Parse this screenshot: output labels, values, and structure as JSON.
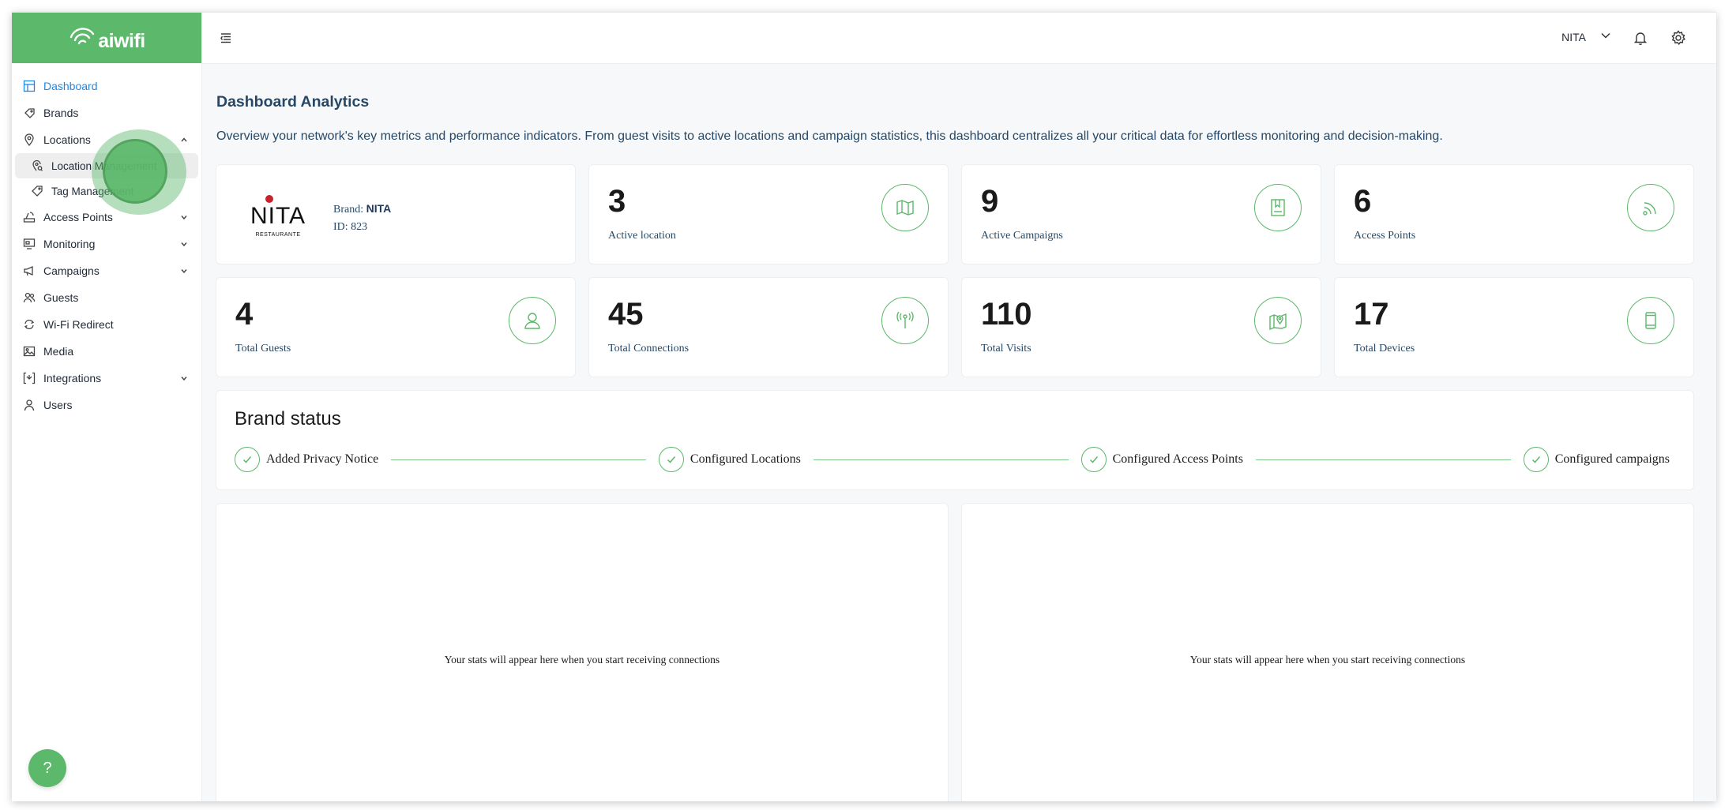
{
  "brand_app": {
    "logo_text": "aiwifi",
    "brand_color": "#5cb86a"
  },
  "sidebar": {
    "items": [
      {
        "label": "Dashboard",
        "icon": "dashboard-icon",
        "active": true
      },
      {
        "label": "Brands",
        "icon": "brands-icon"
      },
      {
        "label": "Locations",
        "icon": "location-pin-icon",
        "expanded": true
      },
      {
        "label": "Access Points",
        "icon": "access-point-icon"
      },
      {
        "label": "Monitoring",
        "icon": "monitor-icon"
      },
      {
        "label": "Campaigns",
        "icon": "megaphone-icon"
      },
      {
        "label": "Guests",
        "icon": "guests-icon"
      },
      {
        "label": "Wi-Fi Redirect",
        "icon": "redirect-icon"
      },
      {
        "label": "Media",
        "icon": "media-icon"
      },
      {
        "label": "Integrations",
        "icon": "integrations-icon"
      },
      {
        "label": "Users",
        "icon": "user-icon"
      }
    ],
    "locations_sub": [
      {
        "label": "Location Management",
        "icon": "location-search-icon",
        "selected": true
      },
      {
        "label": "Tag Management",
        "icon": "tag-icon"
      }
    ],
    "help_label": "?"
  },
  "topbar": {
    "user": "NITA"
  },
  "page": {
    "title": "Dashboard Analytics",
    "description": "Overview your network's key metrics and performance indicators. From guest visits to active locations and campaign statistics, this dashboard centralizes all your critical data for effortless monitoring and decision-making."
  },
  "brand_card": {
    "logo_word": "NITA",
    "logo_sub": "RESTAURANTE",
    "brand_prefix": "Brand: ",
    "brand_name": "NITA",
    "id_text": "ID: 823"
  },
  "stats": [
    {
      "value": "3",
      "label": "Active location",
      "icon": "map-icon"
    },
    {
      "value": "9",
      "label": "Active Campaigns",
      "icon": "book-icon"
    },
    {
      "value": "6",
      "label": "Access Points",
      "icon": "wifi-signal-icon"
    },
    {
      "value": "4",
      "label": "Total Guests",
      "icon": "guest-icon"
    },
    {
      "value": "45",
      "label": "Total Connections",
      "icon": "antenna-icon"
    },
    {
      "value": "110",
      "label": "Total Visits",
      "icon": "map-pin-icon"
    },
    {
      "value": "17",
      "label": "Total Devices",
      "icon": "phone-icon"
    }
  ],
  "brand_status": {
    "title": "Brand status",
    "steps": [
      "Added Privacy Notice",
      "Configured Locations",
      "Configured Access Points",
      "Configured campaigns"
    ]
  },
  "empty_panels": [
    "Your stats will appear here when you start receiving connections",
    "Your stats will appear here when you start receiving connections"
  ]
}
